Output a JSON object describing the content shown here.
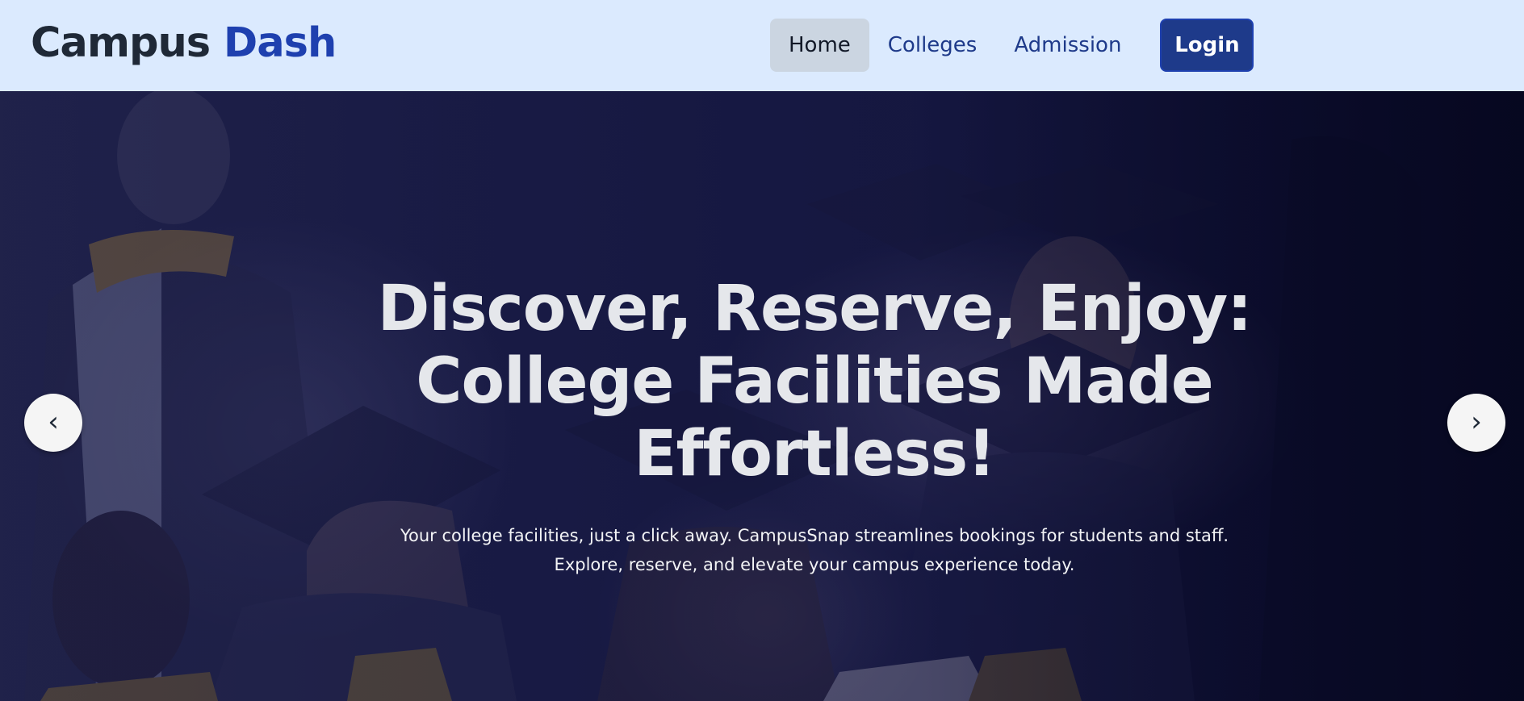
{
  "brand": {
    "name_primary": "Campus",
    "name_accent": "Dash",
    "accent_color": "#1e40af"
  },
  "nav": {
    "links": [
      {
        "label": "Home",
        "active": true
      },
      {
        "label": "Colleges",
        "active": false
      },
      {
        "label": "Admission",
        "active": false
      }
    ],
    "login_label": "Login"
  },
  "hero": {
    "title": "Discover, Reserve, Enjoy: College Facilities Made Effortless!",
    "subtitle": "Your college facilities, just a click away. CampusSnap streamlines bookings for students and staff. Explore, reserve, and elevate your campus experience today.",
    "prev_icon": "chevron-left-icon",
    "next_icon": "chevron-right-icon",
    "prev_glyph": "‹",
    "next_glyph": "›"
  },
  "colors": {
    "navbar_bg": "#dbeafe",
    "login_bg": "#1e3a8a",
    "active_link_bg": "#cbd5e1"
  }
}
